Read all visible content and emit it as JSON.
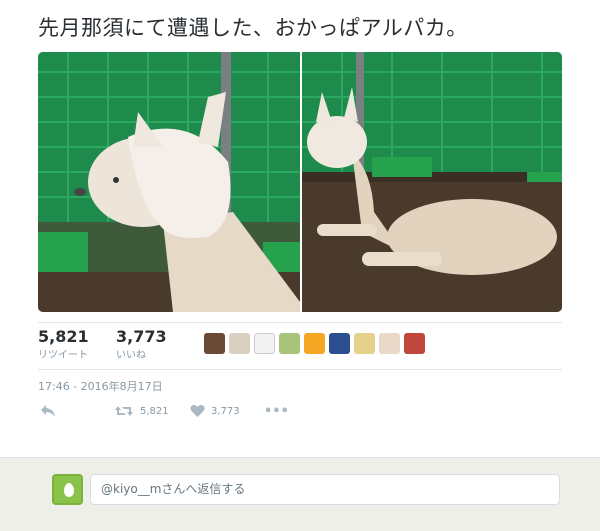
{
  "tweet": {
    "text": "先月那須にて遭遇した、おかっぱアルパカ。",
    "timestamp": "17:46 - 2016年8月17日"
  },
  "media": {
    "photos": [
      {
        "name": "alpaca-closeup",
        "subject": "alpaca with bob haircut, side profile"
      },
      {
        "name": "alpaca-lying",
        "subject": "sheared alpaca lying down in pen"
      }
    ]
  },
  "stats": {
    "retweets_count": "5,821",
    "retweets_label": "リツイート",
    "likes_count": "3,773",
    "likes_label": "いいね",
    "liker_avatars": 10
  },
  "actions": {
    "retweet_count": "5,821",
    "like_count": "3,773",
    "more": "•••"
  },
  "reply": {
    "placeholder": "@kiyo__mさんへ返信する"
  },
  "colors": {
    "text": "#292f33",
    "muted": "#8899a6",
    "border": "#e1e8ed",
    "reply_bg": "#efefea",
    "egg_avatar": "#8bc34a"
  }
}
